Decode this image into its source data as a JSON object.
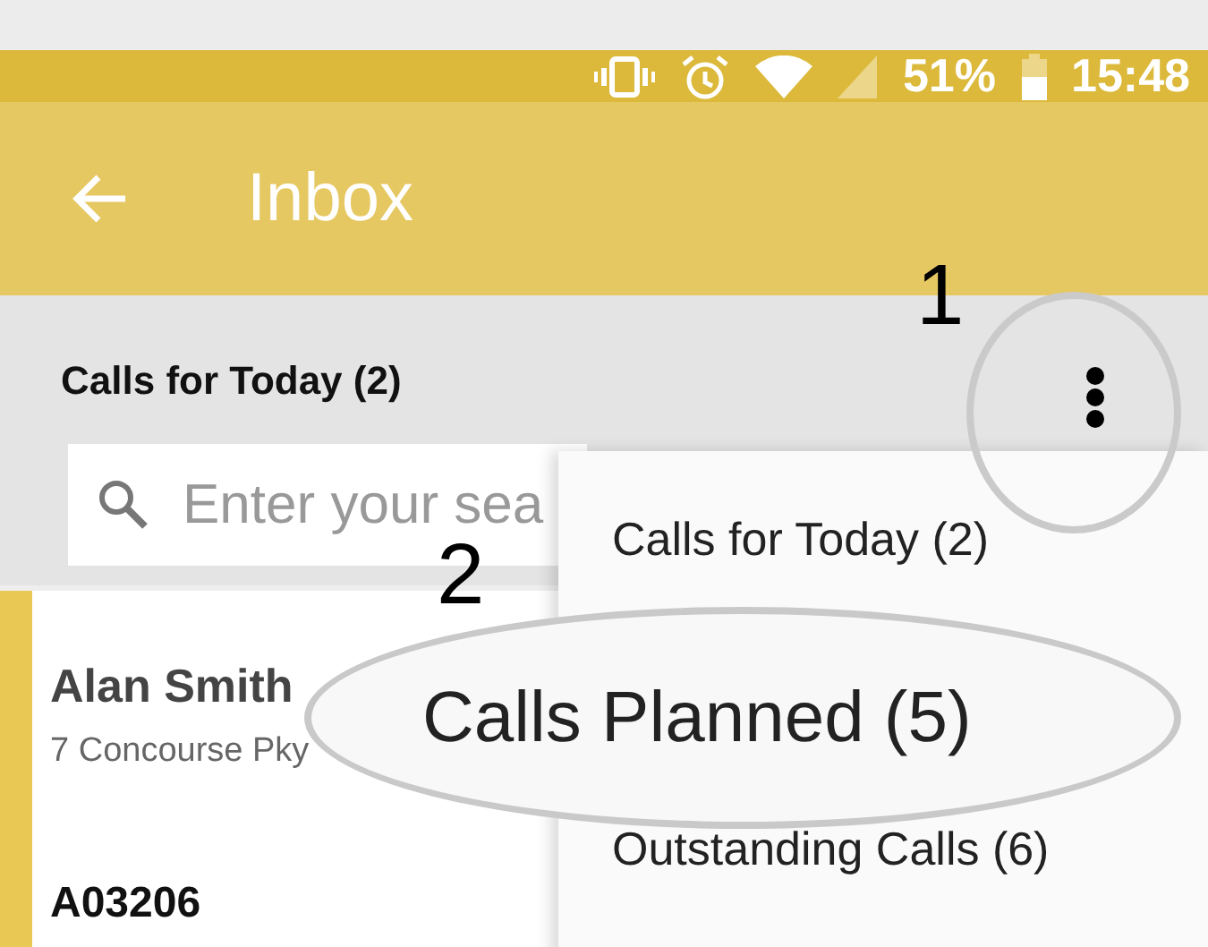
{
  "status_bar": {
    "battery_text": "51%",
    "time": "15:48"
  },
  "app_bar": {
    "title": "Inbox"
  },
  "list_header": {
    "title": "Calls for Today (2)"
  },
  "search": {
    "placeholder": "Enter your sea"
  },
  "list": [
    {
      "name": "Alan Smith",
      "address": "7 Concourse Pky",
      "code": "A03206"
    }
  ],
  "menu": {
    "items": [
      "Calls for Today (2)",
      "Outstanding Calls (6)"
    ]
  },
  "magnifier": {
    "text": "Calls Planned (5)"
  },
  "annotations": [
    {
      "label": "1"
    },
    {
      "label": "2"
    }
  ]
}
